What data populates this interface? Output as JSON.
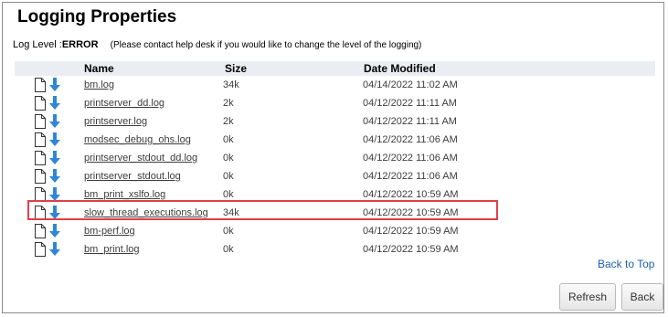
{
  "page": {
    "title": "Logging Properties",
    "log_level_label": "Log Level :",
    "log_level_value": "ERROR",
    "log_level_note": "(Please contact help desk if you would like to change the level of the logging)"
  },
  "table": {
    "columns": {
      "name": "Name",
      "size": "Size",
      "date": "Date Modified"
    },
    "rows": [
      {
        "name": "bm.log",
        "size": "34k",
        "date": "04/14/2022 11:02 AM"
      },
      {
        "name": "printserver_dd.log",
        "size": "2k",
        "date": "04/12/2022 11:11 AM"
      },
      {
        "name": "printserver.log",
        "size": "2k",
        "date": "04/12/2022 11:11 AM"
      },
      {
        "name": "modsec_debug_ohs.log",
        "size": "0k",
        "date": "04/12/2022 11:06 AM"
      },
      {
        "name": "printserver_stdout_dd.log",
        "size": "0k",
        "date": "04/12/2022 11:06 AM"
      },
      {
        "name": "printserver_stdout.log",
        "size": "0k",
        "date": "04/12/2022 11:06 AM"
      },
      {
        "name": "bm_print_xslfo.log",
        "size": "0k",
        "date": "04/12/2022 10:59 AM"
      },
      {
        "name": "slow_thread_executions.log",
        "size": "34k",
        "date": "04/12/2022 10:59 AM"
      },
      {
        "name": "bm-perf.log",
        "size": "0k",
        "date": "04/12/2022 10:59 AM"
      },
      {
        "name": "bm_print.log",
        "size": "0k",
        "date": "04/12/2022 10:59 AM"
      }
    ],
    "row_icons": [
      "file-icon",
      "download-arrow-icon"
    ],
    "highlighted_row_index": 7
  },
  "links": {
    "back_to_top": "Back to Top"
  },
  "buttons": {
    "refresh": "Refresh",
    "back": "Back"
  },
  "colors": {
    "header_bg": "#eaeef2",
    "highlight_border": "#e0404a",
    "download_arrow": "#2f86d6",
    "link": "#1f5fa8"
  }
}
